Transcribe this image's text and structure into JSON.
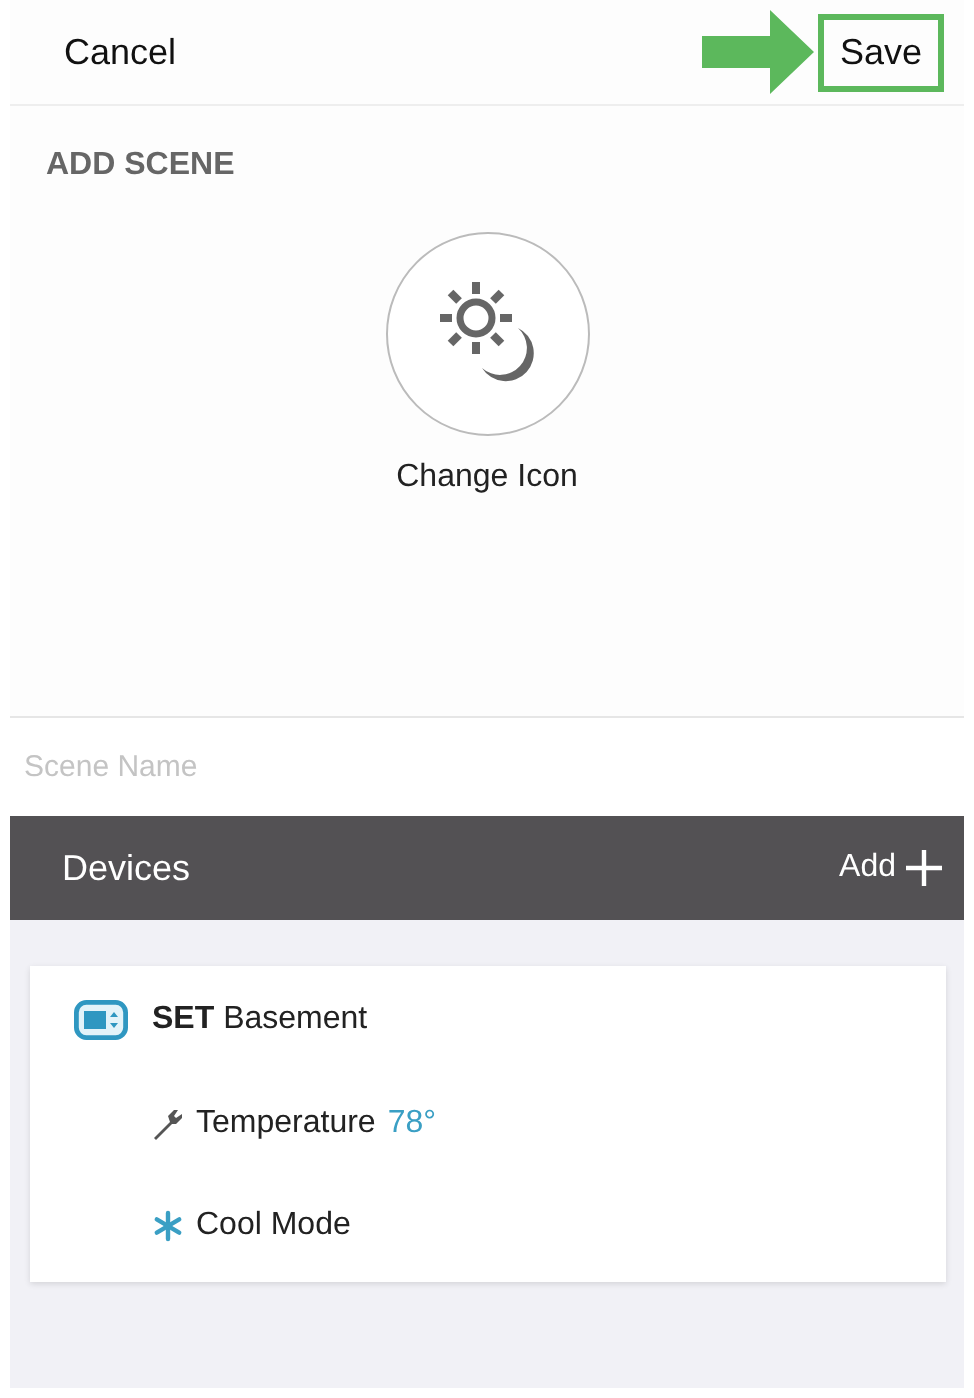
{
  "nav": {
    "cancel": "Cancel",
    "save": {
      "label": "Save",
      "highlighted": true
    }
  },
  "section_title": "ADD SCENE",
  "icon_picker": {
    "label": "Change Icon"
  },
  "scene_name": {
    "placeholder": "Scene Name"
  },
  "devices_bar": {
    "title": "Devices",
    "add": "Add"
  },
  "devices": [
    {
      "name": "**SET** Basement",
      "settings": [
        {
          "kind": "wrench",
          "label": "Temperature",
          "value": "78°"
        },
        {
          "kind": "snowflake",
          "label": "Cool Mode"
        }
      ]
    }
  ]
}
